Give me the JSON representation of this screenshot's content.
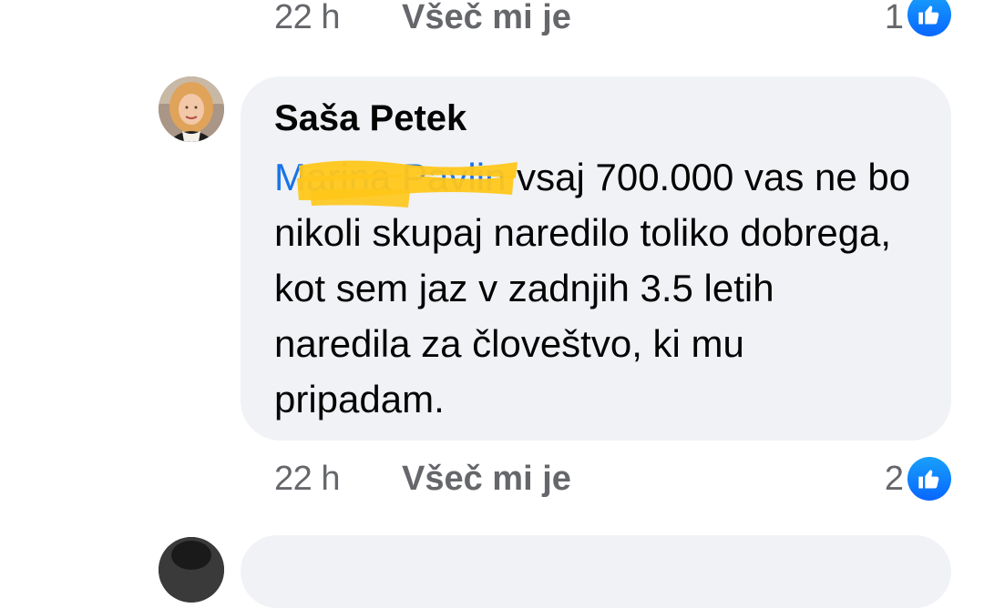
{
  "comment_prev": {
    "time": "22 h",
    "like_label": "Všeč mi je",
    "like_count": "1"
  },
  "comment": {
    "author": "Saša Petek",
    "mention": "Marina Pavlin",
    "text": " vsaj 700.000 vas ne bo nikoli skupaj naredilo toliko dobrega, kot sem jaz v zadnjih 3.5 letih naredila za človeštvo, ki mu pripadam.",
    "time": "22 h",
    "like_label": "Všeč mi je",
    "like_count": "2"
  },
  "icons": {
    "like_badge": "thumbs-up-icon",
    "avatar": "profile-photo",
    "redaction": "yellow-marker-scribble"
  },
  "colors": {
    "link_blue": "#1a73e8",
    "like_blue": "#0866ff",
    "bubble_bg": "#f0f2f5",
    "meta_gray": "#65676b",
    "redaction_yellow": "#ffc61a"
  }
}
